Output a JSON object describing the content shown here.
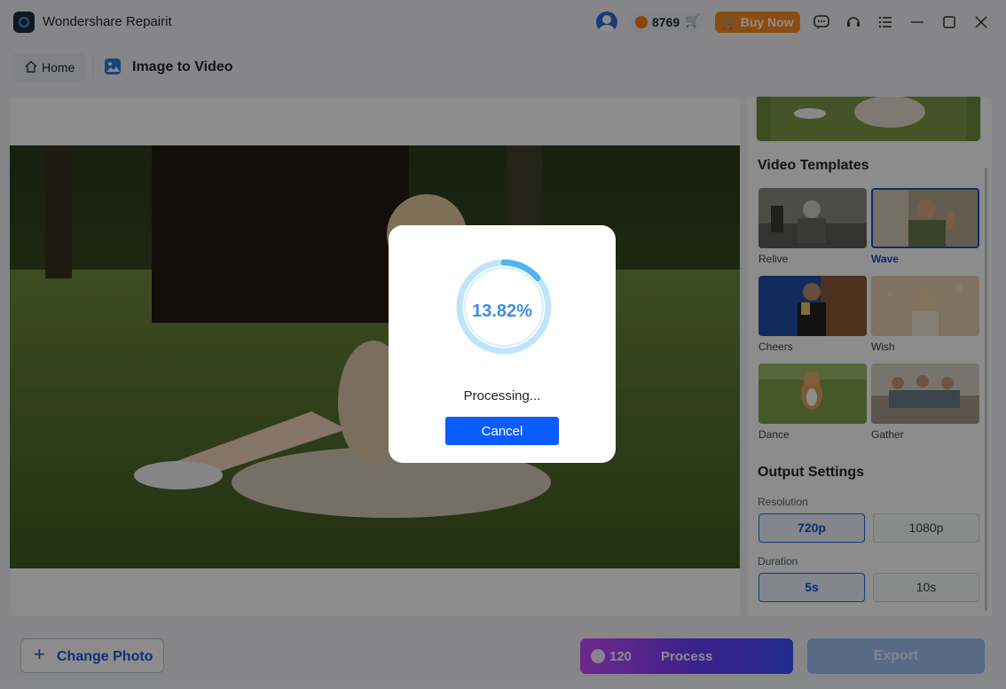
{
  "app": {
    "title": "Wondershare Repairit",
    "credits": "8769",
    "buy_now": "Buy Now"
  },
  "breadcrumb": {
    "home": "Home",
    "page_title": "Image to Video"
  },
  "sidebar": {
    "templates_title": "Video Templates",
    "templates": [
      {
        "label": "Relive",
        "selected": false
      },
      {
        "label": "Wave",
        "selected": true
      },
      {
        "label": "Cheers",
        "selected": false
      },
      {
        "label": "Wish",
        "selected": false
      },
      {
        "label": "Dance",
        "selected": false
      },
      {
        "label": "Gather",
        "selected": false
      }
    ],
    "output_title": "Output Settings",
    "resolution_label": "Resolution",
    "resolution_options": [
      "720p",
      "1080p"
    ],
    "resolution_selected": "720p",
    "duration_label": "Duration",
    "duration_options": [
      "5s",
      "10s"
    ],
    "duration_selected": "5s"
  },
  "bottombar": {
    "change_photo": "Change Photo",
    "process_cost": "120",
    "process": "Process",
    "export": "Export"
  },
  "dialog": {
    "progress": "13.82%",
    "progress_fraction": 0.1382,
    "status": "Processing...",
    "cancel": "Cancel"
  },
  "colors": {
    "accent": "#0a5cff",
    "selected_border": "#1f4fbf",
    "buy_now": "#ff8a1f",
    "progress_ring": "#4fb4f0"
  },
  "icons": [
    "app-logo-icon",
    "avatar-icon",
    "coin-icon",
    "cart-icon",
    "chat-icon",
    "headset-icon",
    "menu-icon",
    "minimize-icon",
    "maximize-icon",
    "close-icon",
    "home-icon",
    "image-icon",
    "plus-icon"
  ]
}
